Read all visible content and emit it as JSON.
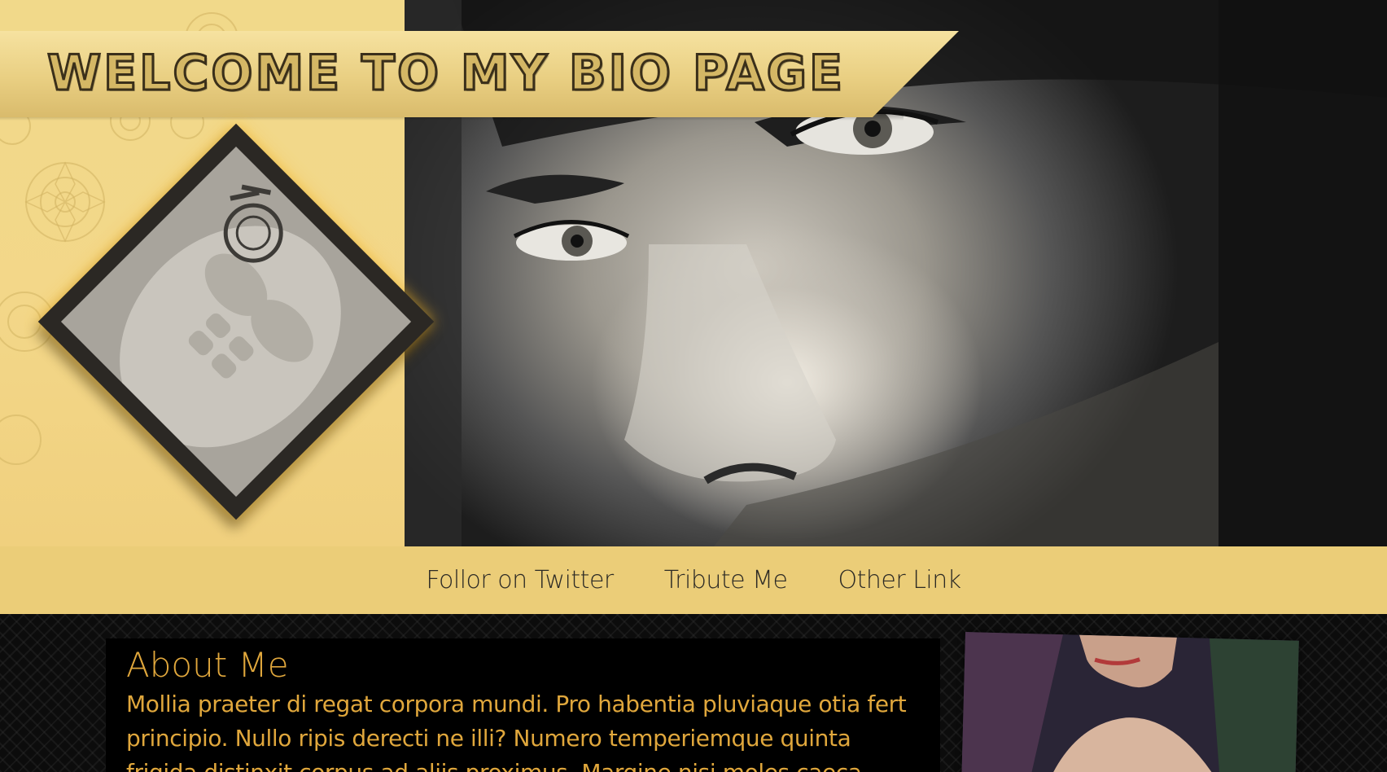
{
  "hero": {
    "title": "WELCOME TO MY BIO PAGE"
  },
  "nav": {
    "links": [
      {
        "label": "Follor on Twitter"
      },
      {
        "label": "Tribute Me"
      },
      {
        "label": "Other Link"
      }
    ]
  },
  "about": {
    "heading": "About Me",
    "text": "Mollia praeter di regat corpora mundi. Pro habentia pluviaque otia fert principio. Nullo ripis derecti ne illi? Numero temperiemque quinta frigida distinxit corpus ad aliis proximus. Margine nisi moles caeca"
  },
  "colors": {
    "gold": "#ebcd78",
    "text_accent": "#e0a73c",
    "nav_text": "#2c2a25"
  }
}
